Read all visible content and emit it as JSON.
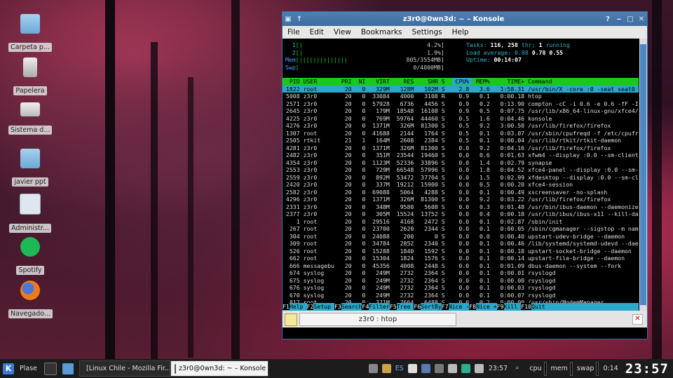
{
  "desktop_icons": [
    {
      "label": "Carpeta p...",
      "icon": "folder-icon"
    },
    {
      "label": "Papelera",
      "icon": "trash-icon"
    },
    {
      "label": "Sistema d...",
      "icon": "drive-icon"
    },
    {
      "label": "javier ppt",
      "icon": "folder-icon"
    },
    {
      "label": "Administr...",
      "icon": "settings-icon"
    },
    {
      "label": "Spotify",
      "icon": "spotify-icon"
    },
    {
      "label": "Navegado...",
      "icon": "firefox-icon"
    }
  ],
  "window": {
    "title": "z3r0@0wn3d: ~ – Konsole"
  },
  "menu": [
    "File",
    "Edit",
    "View",
    "Bookmarks",
    "Settings",
    "Help"
  ],
  "htop": {
    "meters": [
      {
        "label": "1",
        "bar": "[|",
        "value": "4.2%]"
      },
      {
        "label": "2",
        "bar": "[|",
        "value": "1.9%]"
      },
      {
        "label": "Mem",
        "bar": "[||||||||||||||",
        "value": "805/3554MB]"
      },
      {
        "label": "Swp",
        "bar": "[",
        "value": "0/4000MB]"
      }
    ],
    "tasks": {
      "label": "Tasks:",
      "procs": "116,",
      "thr": "258",
      "thr_label": "thr;",
      "running": "1",
      "running_label": "running"
    },
    "load": {
      "label": "Load average:",
      "v1": "0.88",
      "v2": "0.78",
      "v3": "0.55"
    },
    "uptime": {
      "label": "Uptime:",
      "value": "00:14:07"
    },
    "columns": [
      "PID",
      "USER",
      "PRI",
      "NI",
      "VIRT",
      "RES",
      "SHR",
      "S",
      "CPU%",
      "MEM%",
      "TIME+",
      "Command"
    ],
    "rows": [
      [
        "1822",
        "root",
        "20",
        "0",
        "329M",
        "128M",
        "102M",
        "S",
        "2.8",
        "3.6",
        "1:58.31",
        "/usr/bin/X -core :0 -seat seat0 -auth /v"
      ],
      [
        "5008",
        "z3r0",
        "20",
        "0",
        "33084",
        "4000",
        "3108",
        "R",
        "0.9",
        "0.1",
        "0:00.18",
        "htop"
      ],
      [
        "2571",
        "z3r0",
        "20",
        "0",
        "57928",
        "6736",
        "4456",
        "S",
        "0.9",
        "0.2",
        "0:13.90",
        "compton -cC -i 0.6 -e 0.6 -fF -I 0.065 -"
      ],
      [
        "2645",
        "z3r0",
        "20",
        "0",
        "179M",
        "18548",
        "16108",
        "S",
        "0.9",
        "0.5",
        "0:07.75",
        "/usr/lib/x86_64-linux-gnu/xfce4/panel/wr"
      ],
      [
        "4225",
        "z3r0",
        "20",
        "0",
        "769M",
        "59764",
        "44460",
        "S",
        "0.5",
        "1.6",
        "0:04.46",
        "konsole"
      ],
      [
        "4276",
        "z3r0",
        "20",
        "0",
        "1371M",
        "326M",
        "81300",
        "S",
        "0.5",
        "9.2",
        "3:00.50",
        "/usr/lib/firefox/firefox"
      ],
      [
        "1307",
        "root",
        "20",
        "0",
        "41688",
        "2144",
        "1764",
        "S",
        "0.5",
        "0.1",
        "0:03.07",
        "/usr/sbin/cpufreqd -f /etc/cpufreqd.conf"
      ],
      [
        "2505",
        "rtkit",
        "21",
        "1",
        "164M",
        "2608",
        "2384",
        "S",
        "0.5",
        "0.1",
        "0:00.04",
        "/usr/lib/rtkit/rtkit-daemon"
      ],
      [
        "4281",
        "z3r0",
        "20",
        "0",
        "1371M",
        "326M",
        "81300",
        "S",
        "0.0",
        "9.2",
        "0:04.16",
        "/usr/lib/firefox/firefox"
      ],
      [
        "2482",
        "z3r0",
        "20",
        "0",
        "351M",
        "23544",
        "19460",
        "S",
        "0.0",
        "0.6",
        "0:01.63",
        "xfwm4 --display :0.0 --sm-client-id 2e8b"
      ],
      [
        "4354",
        "z3r0",
        "20",
        "0",
        "1123M",
        "52336",
        "33896",
        "S",
        "0.0",
        "1.4",
        "0:02.79",
        "synapse"
      ],
      [
        "2553",
        "z3r0",
        "20",
        "0",
        "729M",
        "66548",
        "57996",
        "S",
        "0.0",
        "1.8",
        "0:04.52",
        "xfce4-panel --display :0.0 --sm-client-i"
      ],
      [
        "2559",
        "z3r0",
        "20",
        "0",
        "892M",
        "53472",
        "37704",
        "S",
        "0.0",
        "1.5",
        "0:02.99",
        "xfdesktop --display :0.0 --sm-client-id"
      ],
      [
        "2420",
        "z3r0",
        "20",
        "0",
        "337M",
        "19212",
        "15900",
        "S",
        "0.0",
        "0.5",
        "0:00.20",
        "xfce4-session"
      ],
      [
        "2582",
        "z3r0",
        "20",
        "0",
        "69088",
        "5064",
        "4288",
        "S",
        "0.0",
        "0.1",
        "0:00.49",
        "xscreensaver -no-splash"
      ],
      [
        "4296",
        "z3r0",
        "20",
        "0",
        "1371M",
        "326M",
        "81300",
        "S",
        "0.0",
        "9.2",
        "0:03.22",
        "/usr/lib/firefox/firefox"
      ],
      [
        "2331",
        "z3r0",
        "20",
        "0",
        "348M",
        "9580",
        "5608",
        "S",
        "0.0",
        "0.3",
        "0:01.48",
        "/usr/bin/ibus-daemon --daemonize --xim"
      ],
      [
        "2377",
        "z3r0",
        "20",
        "0",
        "305M",
        "15524",
        "13752",
        "S",
        "0.0",
        "0.4",
        "0:00.18",
        "/usr/lib/ibus/ibus-x11 --kill-daemon"
      ],
      [
        "1",
        "root",
        "20",
        "0",
        "29516",
        "4168",
        "2472",
        "S",
        "0.0",
        "0.1",
        "0:02.87",
        "/sbin/init"
      ],
      [
        "267",
        "root",
        "20",
        "0",
        "23700",
        "2620",
        "2344",
        "S",
        "0.0",
        "0.1",
        "0:00.05",
        "/sbin/cgmanager --sigstop -m name=system"
      ],
      [
        "304",
        "root",
        "20",
        "0",
        "24088",
        "200",
        "0",
        "S",
        "0.0",
        "0.0",
        "0:00.40",
        "upstart-udev-bridge --daemon"
      ],
      [
        "309",
        "root",
        "20",
        "0",
        "34784",
        "2852",
        "2340",
        "S",
        "0.0",
        "0.1",
        "0:00.46",
        "/lib/systemd/systemd-udevd --daemon"
      ],
      [
        "526",
        "root",
        "20",
        "0",
        "15288",
        "1840",
        "1592",
        "S",
        "0.0",
        "0.1",
        "0:00.18",
        "upstart-socket-bridge --daemon"
      ],
      [
        "662",
        "root",
        "20",
        "0",
        "15304",
        "1824",
        "1576",
        "S",
        "0.0",
        "0.1",
        "0:00.14",
        "upstart-file-bridge --daemon"
      ],
      [
        "666",
        "messagebu",
        "20",
        "0",
        "45356",
        "4008",
        "2448",
        "S",
        "0.0",
        "0.1",
        "0:01.09",
        "dbus-daemon --system --fork"
      ],
      [
        "674",
        "syslog",
        "20",
        "0",
        "249M",
        "2732",
        "2364",
        "S",
        "0.0",
        "0.1",
        "0:00.01",
        "rsyslogd"
      ],
      [
        "675",
        "syslog",
        "20",
        "0",
        "249M",
        "2732",
        "2364",
        "S",
        "0.0",
        "0.1",
        "0:00.00",
        "rsyslogd"
      ],
      [
        "676",
        "syslog",
        "20",
        "0",
        "249M",
        "2732",
        "2364",
        "S",
        "0.0",
        "0.1",
        "0:00.03",
        "rsyslogd"
      ],
      [
        "670",
        "syslog",
        "20",
        "0",
        "249M",
        "2732",
        "2364",
        "S",
        "0.0",
        "0.1",
        "0:00.07",
        "rsyslogd"
      ],
      [
        "817",
        "root",
        "20",
        "0",
        "321M",
        "7664",
        "6488",
        "S",
        "0.0",
        "0.2",
        "0:00.00",
        "/usr/sbin/ModemManager"
      ]
    ],
    "fkeys": [
      {
        "key": "F1",
        "label": "Help"
      },
      {
        "key": "F2",
        "label": "Setup"
      },
      {
        "key": "F3",
        "label": "Search"
      },
      {
        "key": "F4",
        "label": "Filter"
      },
      {
        "key": "F5",
        "label": "Tree"
      },
      {
        "key": "F6",
        "label": "SortBy"
      },
      {
        "key": "F7",
        "label": "Nice -"
      },
      {
        "key": "F8",
        "label": "Nice +"
      },
      {
        "key": "F9",
        "label": "Kill"
      },
      {
        "key": "F10",
        "label": "Quit"
      }
    ]
  },
  "tab": {
    "label": "z3r0 : htop"
  },
  "taskbar": {
    "places": "Plase",
    "tasks": [
      "[Linux Chile - Mozilla Fir...",
      "z3r0@0wn3d: ~ – Konsole"
    ],
    "lang": "ES",
    "time": "23:57",
    "cpu": "cpu",
    "mem": "mem",
    "swap": "swap",
    "uptime": "0:14",
    "big_clock": "23:57"
  },
  "colors": {
    "meter_bar": "#19d119",
    "header": "#19c819",
    "selected": "#2aa7c9",
    "titlebar": "#3e6d9f"
  }
}
